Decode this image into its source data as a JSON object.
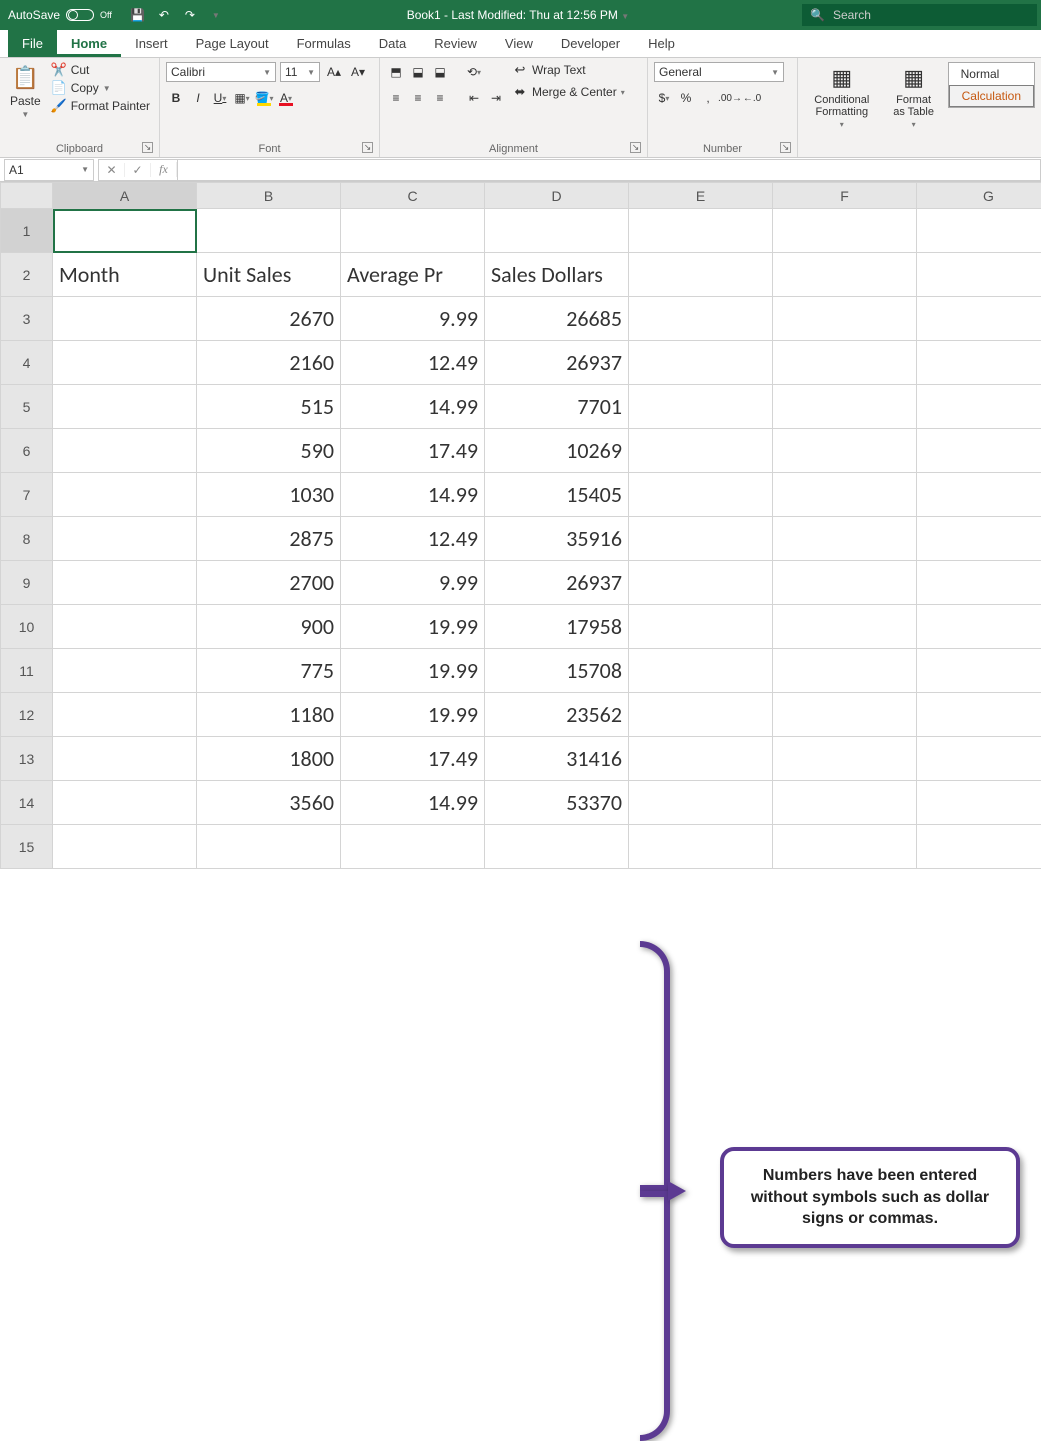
{
  "title": {
    "autosave": "AutoSave",
    "toggle": "Off",
    "doc": "Book1  -  Last Modified: Thu at 12:56 PM",
    "search_placeholder": "Search"
  },
  "tabs": [
    "File",
    "Home",
    "Insert",
    "Page Layout",
    "Formulas",
    "Data",
    "Review",
    "View",
    "Developer",
    "Help"
  ],
  "ribbon": {
    "clipboard": {
      "paste": "Paste",
      "cut": "Cut",
      "copy": "Copy",
      "painter": "Format Painter",
      "label": "Clipboard"
    },
    "font": {
      "name": "Calibri",
      "size": "11",
      "label": "Font"
    },
    "align": {
      "wrap": "Wrap Text",
      "merge": "Merge & Center",
      "label": "Alignment"
    },
    "number": {
      "format": "General",
      "label": "Number"
    },
    "styles": {
      "cond": "Conditional Formatting",
      "fat": "Format as Table",
      "normal": "Normal",
      "calc": "Calculation"
    }
  },
  "namebox": "A1",
  "formula": "",
  "columns": [
    "A",
    "B",
    "C",
    "D",
    "E",
    "F",
    "G"
  ],
  "chart_data": {
    "type": "table",
    "headers": [
      "Month",
      "Unit Sales",
      "Average Pr",
      "Sales Dollars"
    ],
    "rows": [
      [
        "",
        2670,
        9.99,
        26685
      ],
      [
        "",
        2160,
        12.49,
        26937
      ],
      [
        "",
        515,
        14.99,
        7701
      ],
      [
        "",
        590,
        17.49,
        10269
      ],
      [
        "",
        1030,
        14.99,
        15405
      ],
      [
        "",
        2875,
        12.49,
        35916
      ],
      [
        "",
        2700,
        9.99,
        26937
      ],
      [
        "",
        900,
        19.99,
        17958
      ],
      [
        "",
        775,
        19.99,
        15708
      ],
      [
        "",
        1180,
        19.99,
        23562
      ],
      [
        "",
        1800,
        17.49,
        31416
      ],
      [
        "",
        3560,
        14.99,
        53370
      ]
    ]
  },
  "annotation": "Numbers have been entered without symbols such as dollar signs or commas."
}
